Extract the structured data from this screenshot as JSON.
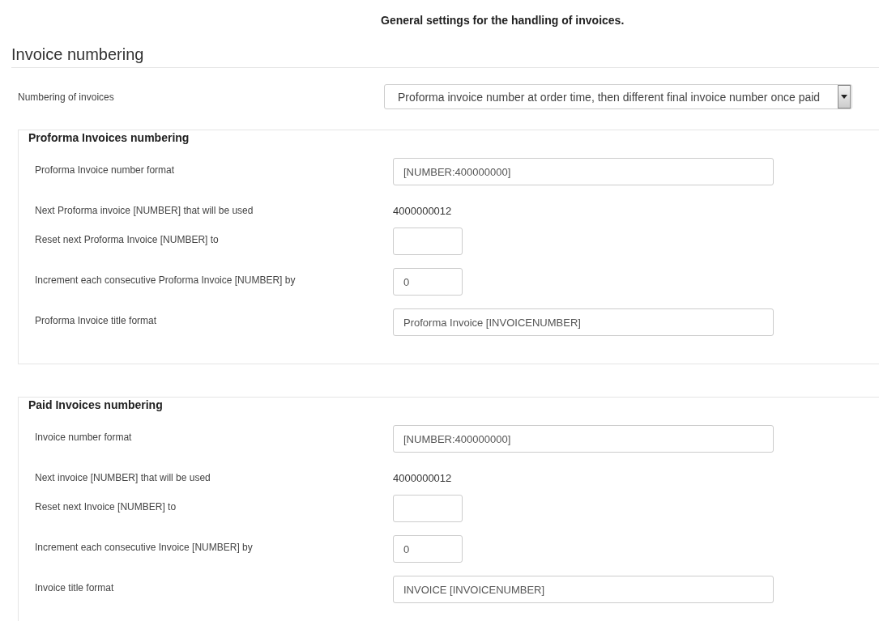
{
  "intro": "General settings for the handling of invoices.",
  "section_title": "Invoice numbering",
  "numbering": {
    "label": "Numbering of invoices",
    "value": "Proforma invoice number at order time, then different final invoice number once paid"
  },
  "groups": [
    {
      "legend": "Proforma Invoices numbering",
      "fields": [
        {
          "kind": "text",
          "label": "Proforma Invoice number format",
          "value": "[NUMBER:400000000]"
        },
        {
          "kind": "static",
          "label": "Next Proforma invoice [NUMBER] that will be used",
          "value": "4000000012"
        },
        {
          "kind": "short",
          "label": "Reset next Proforma Invoice [NUMBER] to"
        },
        {
          "kind": "short",
          "label": "Increment each consecutive Proforma Invoice [NUMBER] by",
          "value": "0"
        },
        {
          "kind": "text",
          "label": "Proforma Invoice title format",
          "value": "Proforma Invoice [INVOICENUMBER]"
        }
      ]
    },
    {
      "legend": "Paid Invoices numbering",
      "fields": [
        {
          "kind": "text",
          "label": "Invoice number format",
          "value": "[NUMBER:400000000]"
        },
        {
          "kind": "static",
          "label": "Next invoice [NUMBER] that will be used",
          "value": "4000000012"
        },
        {
          "kind": "short",
          "label": "Reset next Invoice [NUMBER] to"
        },
        {
          "kind": "short",
          "label": "Increment each consecutive Invoice [NUMBER] by",
          "value": "0"
        },
        {
          "kind": "text",
          "label": "Invoice title format",
          "value": "INVOICE [INVOICENUMBER]"
        }
      ]
    }
  ]
}
